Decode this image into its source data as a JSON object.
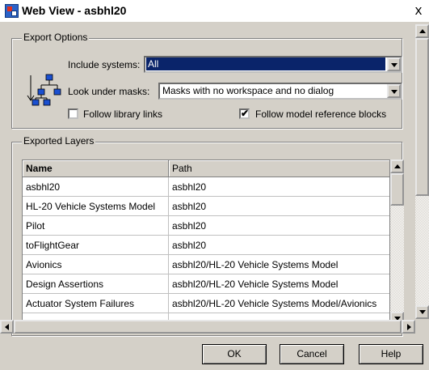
{
  "window": {
    "title": "Web View - asbhl20",
    "close_glyph": "x"
  },
  "export_options": {
    "legend": "Export Options",
    "include_systems_label": "Include systems:",
    "include_systems_value": "All",
    "look_under_masks_label": "Look under masks:",
    "look_under_masks_value": "Masks with no workspace and no dialog",
    "follow_library_links_label": "Follow library links",
    "follow_library_links_checked": false,
    "follow_model_reference_label": "Follow model reference blocks",
    "follow_model_reference_checked": true,
    "check_glyph": "✔",
    "hierarchy_icon": "hierarchy-icon"
  },
  "exported_layers": {
    "legend": "Exported Layers",
    "columns": [
      "Name",
      "Path"
    ],
    "rows": [
      {
        "name": "asbhl20",
        "path": "asbhl20"
      },
      {
        "name": "HL-20 Vehicle Systems Model",
        "path": "asbhl20"
      },
      {
        "name": "Pilot",
        "path": "asbhl20"
      },
      {
        "name": "toFlightGear",
        "path": "asbhl20"
      },
      {
        "name": "Avionics",
        "path": "asbhl20/HL-20 Vehicle Systems Model"
      },
      {
        "name": "Design Assertions",
        "path": "asbhl20/HL-20 Vehicle Systems Model"
      },
      {
        "name": "Actuator  System Failures",
        "path": "asbhl20/HL-20 Vehicle Systems Model/Avionics"
      }
    ]
  },
  "buttons": {
    "ok": "OK",
    "cancel": "Cancel",
    "help": "Help"
  },
  "colors": {
    "face": "#d4d0c8",
    "selection": "#0a246a",
    "title_icon": "#2b63c8"
  }
}
